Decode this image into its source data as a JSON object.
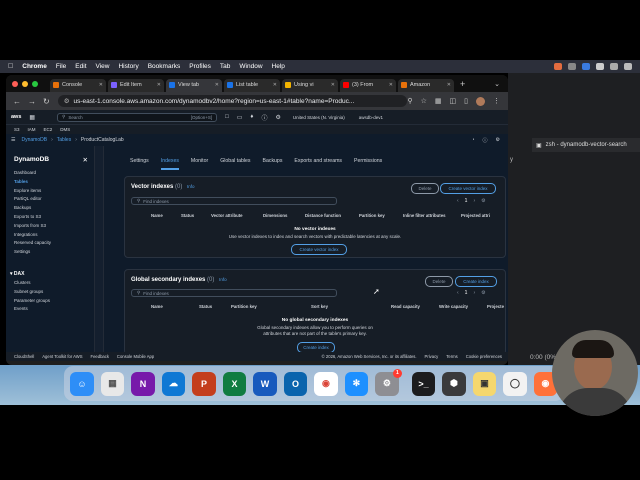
{
  "menubar": {
    "app": "Chrome",
    "items": [
      "File",
      "Edit",
      "View",
      "History",
      "Bookmarks",
      "Profiles",
      "Tab",
      "Window",
      "Help"
    ]
  },
  "tabs": [
    {
      "label": "Console",
      "color": "#e8710a"
    },
    {
      "label": "Edit Item",
      "color": "#7b61ff"
    },
    {
      "label": "View tab",
      "color": "#1a73e8"
    },
    {
      "label": "List table",
      "color": "#1a73e8"
    },
    {
      "label": "Using vi",
      "color": "#f4b400"
    },
    {
      "label": "(3) From",
      "color": "#ff0000"
    },
    {
      "label": "Amazon",
      "color": "#e8710a"
    }
  ],
  "url": "us-east-1.console.aws.amazon.com/dynamodbv2/home?region=us-east-1#table?name=Produc...",
  "aws": {
    "logo": "aws",
    "search_placeholder": "Search",
    "search_shortcut": "[Option+S]",
    "region": "United States (N. Virginia)",
    "account": "awsdb-dev1"
  },
  "favbar": [
    "S3",
    "IAM",
    "EC2",
    "DMS"
  ],
  "breadcrumb": [
    "DynamoDB",
    "Tables",
    "ProductCatalogLab"
  ],
  "sidebar": {
    "title": "DynamoDB",
    "items": [
      "Dashboard",
      "Tables",
      "Explore items",
      "PartiQL editor",
      "Backups",
      "Exports to S3",
      "Imports from S3",
      "Integrations",
      "Reserved capacity",
      "Settings"
    ],
    "dax_title": "DAX",
    "dax_items": [
      "Clusters",
      "Subnet groups",
      "Parameter groups",
      "Events"
    ]
  },
  "subtabs": [
    "Settings",
    "Indexes",
    "Monitor",
    "Global tables",
    "Backups",
    "Exports and streams",
    "Permissions"
  ],
  "vector": {
    "title": "Vector indexes",
    "count": "(0)",
    "info": "Info",
    "delete": "Delete",
    "create": "Create vector index",
    "find": "Find indexes",
    "page": "1",
    "cols": [
      "Name",
      "Status",
      "Vector attribute",
      "Dimensions",
      "Distance function",
      "Partition key",
      "Inline filter attributes",
      "Projected attri"
    ],
    "empty_title": "No vector indexes",
    "empty_desc": "Use vector indexes to index and search vectors with predictable latencies at any scale.",
    "empty_btn": "Create vector index"
  },
  "gsi": {
    "title": "Global secondary indexes",
    "count": "(0)",
    "info": "Info",
    "delete": "Delete",
    "create": "Create index",
    "find": "Find indexes",
    "page": "1",
    "cols": [
      "Name",
      "Status",
      "Partition key",
      "Sort key",
      "Read capacity",
      "Write capacity",
      "Projecte"
    ],
    "empty_title": "No global secondary indexes",
    "empty_desc1": "Global secondary indexes allow you to perform queries on",
    "empty_desc2": "attributes that are not part of the table's primary key.",
    "empty_btn": "Create index"
  },
  "footer": {
    "cloudshell": "CloudShell",
    "toolkit": "Agent Toolkit for AWS",
    "feedback": "Feedback",
    "mobile": "Console Mobile App",
    "copyright": "© 2026, Amazon Web Services, Inc. or its affiliates.",
    "privacy": "Privacy",
    "terms": "Terms",
    "cookie": "Cookie preferences"
  },
  "terminal": {
    "tab": "zsh - dynamodb-vector-search",
    "status": "0:00 (0%)",
    "y": "y"
  }
}
